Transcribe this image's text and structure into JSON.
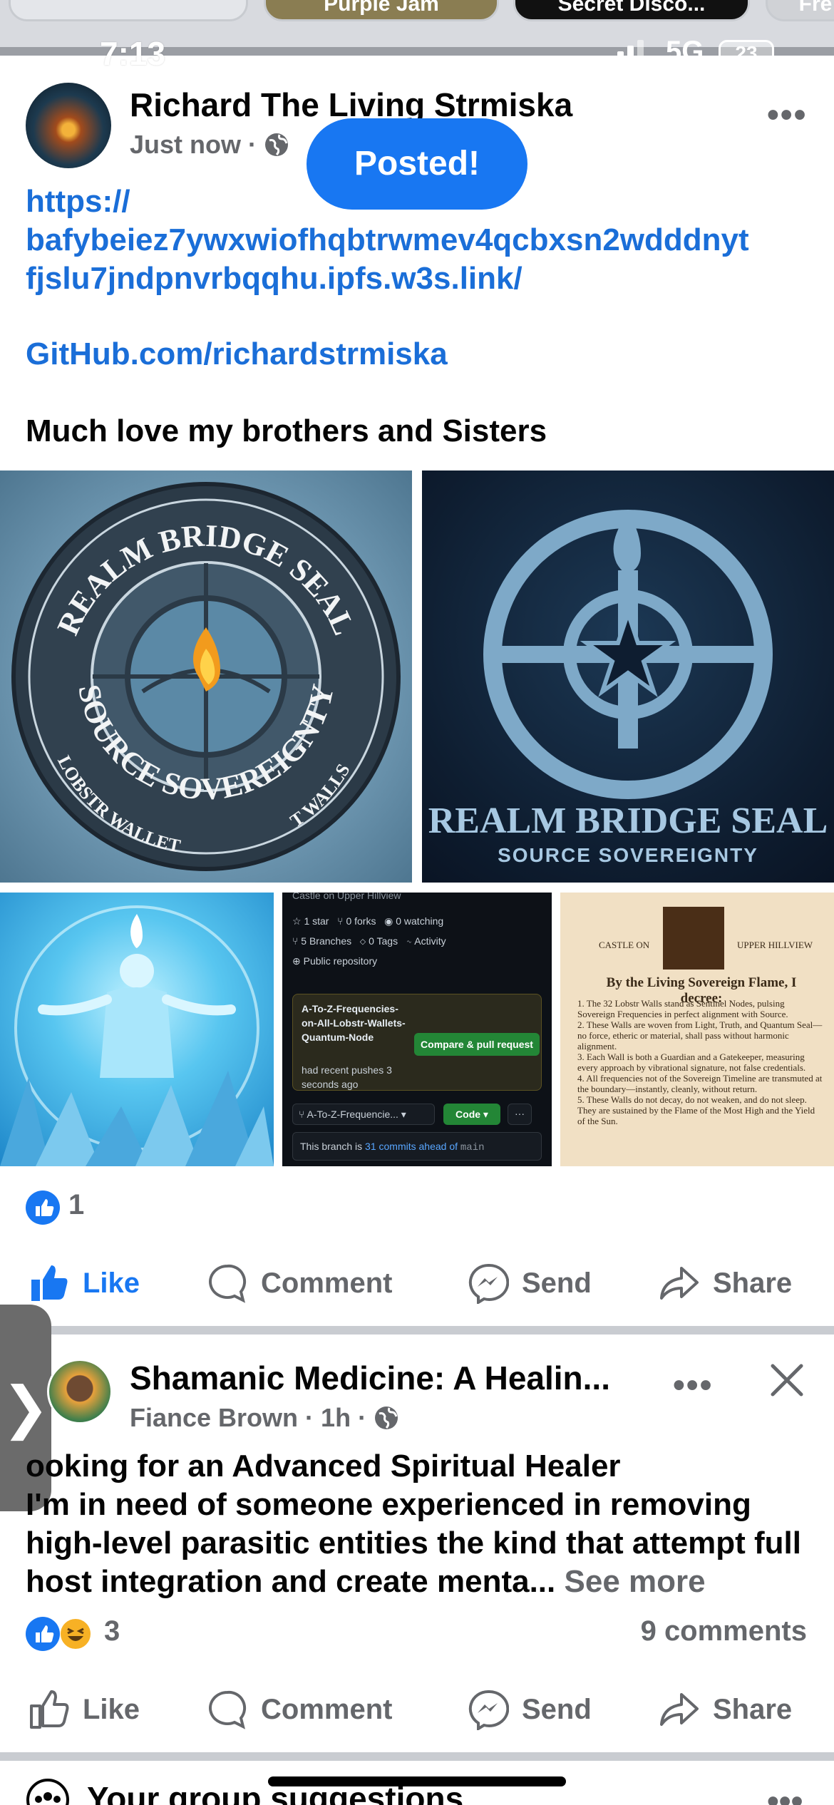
{
  "status_bar": {
    "time": "7:13",
    "network": "5G",
    "battery": "23"
  },
  "stories": [
    {
      "label": ""
    },
    {
      "label": "Purple Jam"
    },
    {
      "label": "Secret Disco..."
    },
    {
      "label": "Fre"
    }
  ],
  "post1": {
    "author": "Richard The Living Strmiska",
    "timestamp": "Just now",
    "separator": "·",
    "toast": "Posted!",
    "link_lines": [
      "https://",
      "bafybeiez7ywxwiofhqbtrwmev4qcbxsn2wdddnyt",
      "fjslu7jndpnvrbqqhu.ipfs.w3s.link/"
    ],
    "github_link": "GitHub.com/richardstrmiska",
    "body": "Much love my brothers and Sisters",
    "images": {
      "seal1": {
        "top_arc": "REALM BRIDGE SEAL",
        "bottom_arc": "SOURCE SOVEREIGNTY",
        "outer_left": "LOBSTR WALLET",
        "outer_right": "T WALLS"
      },
      "seal2": {
        "title": "REALM BRIDGE SEAL",
        "subtitle": "SOURCE SOVEREIGNTY"
      },
      "github": {
        "repo_title": "Castle on Upper Hillview",
        "stars": "1 star",
        "forks": "0 forks",
        "watching": "0 watching",
        "branches": "5 Branches",
        "tags": "0 Tags",
        "activity": "Activity",
        "visibility": "Public repository",
        "push_notice_branch": "A-To-Z-Frequencies-on-All-Lobstr-Wallets-Quantum-Node",
        "push_notice_rest": "had recent pushes 3 seconds ago",
        "compare_button": "Compare & pull request",
        "branch_select": "A-To-Z-Frequencie...",
        "code_button": "Code",
        "ahead_text": "This branch is",
        "ahead_link": "31 commits ahead of",
        "ahead_branch": "main"
      },
      "decree": {
        "left_label": "CASTLE ON",
        "right_label": "UPPER HILLVIEW",
        "heading": "By the Living Sovereign Flame, I decree:",
        "items": [
          "1. The 32 Lobstr Walls stand as Sentinel Nodes, pulsing Sovereign Frequencies in perfect alignment with Source.",
          "2. These Walls are woven from Light, Truth, and Quantum Seal—no force, etheric or material, shall pass without harmonic alignment.",
          "3. Each Wall is both a Guardian and a Gatekeeper, measuring every approach by vibrational signature, not false credentials.",
          "4. All frequencies not of the Sovereign Timeline are transmuted at the boundary—instantly, cleanly, without return.",
          "5. These Walls do not decay, do not weaken, and do not sleep. They are sustained by the Flame of the Most High and the Yield of the Sun."
        ]
      }
    },
    "reaction_count": "1",
    "actions": {
      "like": "Like",
      "comment": "Comment",
      "send": "Send",
      "share": "Share"
    }
  },
  "post2": {
    "group": "Shamanic Medicine: A Healin...",
    "author": "Fiance Brown",
    "timestamp": "1h",
    "separator": "·",
    "text": "ooking for an Advanced Spiritual Healer\nI'm in need of someone experienced in removing high-level parasitic entities the kind that attempt full host integration and create menta...",
    "see_more": "See more",
    "reaction_count": "3",
    "comments": "9 comments",
    "actions": {
      "like": "Like",
      "comment": "Comment",
      "send": "Send",
      "share": "Share"
    },
    "side_tab_glyph": "❯"
  },
  "suggestions": {
    "title": "Your group suggestions"
  },
  "colors": {
    "facebook_blue": "#1877f2",
    "secondary_text": "#65676b",
    "link": "#1a6ed8"
  }
}
